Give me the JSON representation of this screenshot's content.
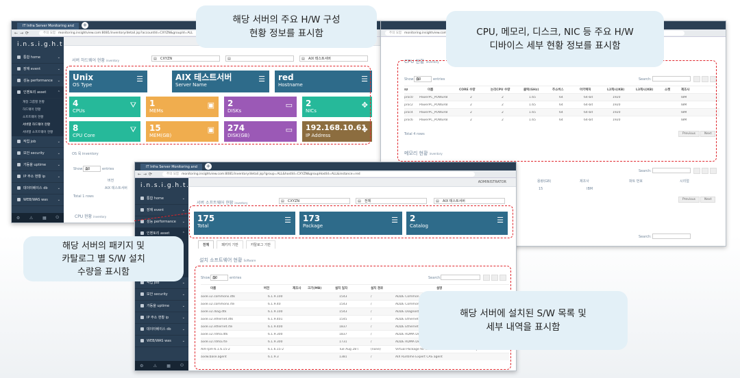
{
  "app": {
    "tab_title": "IT Infra Server Monitoring and",
    "url1": "monitoring.insightview.com:8081/inventory/detail.jsp?accountId=CXYZN&groupId=ALL",
    "url2": "monitoring.insightview.com:8081/inventory/detail.jsp?group=ALL&hostId=CXYZN&groupHostId=ALL&instance=red",
    "url3": "monitoring.insightview.com",
    "url_label": "주의 요함",
    "logo": "i.n.s.i.g.h.t.V.e.w",
    "admin": "ADMINISTRATOR"
  },
  "sidebar": {
    "items": [
      {
        "label": "통합 home"
      },
      {
        "label": "장애 event"
      },
      {
        "label": "성능 performance"
      },
      {
        "label": "인벤토리 asset"
      },
      {
        "label": "작업 job"
      },
      {
        "label": "보안 security"
      },
      {
        "label": "가동율 uptime"
      },
      {
        "label": "IP 주소 현황 ip"
      },
      {
        "label": "데이터베이스 db"
      },
      {
        "label": "WEB/WAS was"
      }
    ],
    "subitems": [
      {
        "label": "계정 그룹별 현황"
      },
      {
        "label": "하드웨어 현황"
      },
      {
        "label": "소프트웨어 현황"
      },
      {
        "label": "서버별 하드웨어 현황"
      },
      {
        "label": "서버별 소프트웨어 현황"
      }
    ]
  },
  "hw_window": {
    "breadcrumb": "서버 하드웨어 현황",
    "breadcrumb_small": "inventory",
    "select1": "CXYZN",
    "select2": "",
    "select3": "AIX 테스트서버",
    "tiles": [
      {
        "value": "Unix",
        "label": "OS Type",
        "icon": "server-icon",
        "color": "blue"
      },
      {
        "value": "AIX 테스트서버",
        "label": "Server Name",
        "icon": "server-icon",
        "color": "blue"
      },
      {
        "value": "red",
        "label": "Hostname",
        "icon": "server-icon",
        "color": "blue"
      },
      {
        "value": "4",
        "label": "CPUs",
        "icon": "road-icon",
        "color": "green"
      },
      {
        "value": "1",
        "label": "MEMs",
        "icon": "archive-icon",
        "color": "orange"
      },
      {
        "value": "2",
        "label": "DISKs",
        "icon": "hdd-icon",
        "color": "purple"
      },
      {
        "value": "2",
        "label": "NICs",
        "icon": "arrows-icon",
        "color": "brown"
      },
      {
        "value": "8",
        "label": "CPU Core",
        "icon": "road-icon",
        "color": "green"
      },
      {
        "value": "15",
        "label": "MEM(GB)",
        "icon": "archive-icon",
        "color": "orange"
      },
      {
        "value": "274",
        "label": "DISK(GB)",
        "icon": "hdd-icon",
        "color": "purple"
      },
      {
        "value": "192.168.10.61",
        "label": "IP Address",
        "icon": "arrows-icon",
        "color": "brown"
      }
    ],
    "os_section": "OS 목 inventory",
    "show": "Show",
    "entries": "entries",
    "show_n": "10",
    "col_version": "버전",
    "row_text": "AIX 테스트서버",
    "total": "Total 1 rows",
    "cpu_section": "CPU 현황",
    "cpu_section_small": "inventory"
  },
  "cpu_window": {
    "panel_title": "CPU 현황",
    "panel_small": "inventory",
    "show": "Show",
    "show_n": "50",
    "entries": "entries",
    "search": "Search:",
    "headers": [
      "ID",
      "이름",
      "CORE 수량",
      "논리CPU 수량",
      "클럭(GHz)",
      "주소버스",
      "아키텍처",
      "L2캐시(KB)",
      "L3캐시(KB)",
      "소켓",
      "제조사"
    ],
    "rows": [
      [
        "proc0",
        "PowerPC_POWER8",
        "2",
        "2",
        "1.65",
        "64",
        "64-bit",
        "1920",
        "",
        "",
        "IBM"
      ],
      [
        "proc2",
        "PowerPC_POWER8",
        "2",
        "2",
        "1.65",
        "64",
        "64-bit",
        "1920",
        "",
        "",
        "IBM"
      ],
      [
        "proc4",
        "PowerPC_POWER8",
        "2",
        "2",
        "1.65",
        "64",
        "64-bit",
        "1920",
        "",
        "",
        "IBM"
      ],
      [
        "proc6",
        "PowerPC_POWER8",
        "2",
        "2",
        "1.65",
        "64",
        "64-bit",
        "1920",
        "",
        "",
        "IBM"
      ]
    ],
    "total": "Total 4 rows",
    "prev": "Previous",
    "next": "Next",
    "mem_title": "메모리 현황",
    "mem_small": "inventory",
    "mem_headers": [
      "용량(GB)",
      "제조사",
      "파트 번호",
      "시리얼"
    ],
    "mem_row": [
      "15",
      "IBM",
      "",
      ""
    ],
    "search2": "Search:",
    "search3": "Search:"
  },
  "sw_window": {
    "breadcrumb": "서버 소프트웨어 현황",
    "breadcrumb_small": "inventory",
    "select1": "CXYZN",
    "select2": "전체",
    "select3": "AIX 테스트서버",
    "tiles": [
      {
        "value": "175",
        "label": "Total",
        "icon": "server-icon"
      },
      {
        "value": "173",
        "label": "Package",
        "icon": "server-icon"
      },
      {
        "value": "2",
        "label": "Catalog",
        "icon": "server-icon"
      }
    ],
    "tabs": [
      "전체",
      "패키지 기반",
      "카탈로그 기반"
    ],
    "section_title": "설치 소프트웨어 현황",
    "section_small": "Software",
    "show": "Show",
    "show_n": "50",
    "entries": "entries",
    "search": "Search:",
    "headers": [
      "이름",
      "버전",
      "제조사",
      "크기(MB)",
      "설치 일자",
      "설치 경로",
      "설명"
    ],
    "rows": [
      [
        "aixle.v2.commonx.dtk",
        "6.1.9.100",
        "",
        "",
        "1543",
        "/",
        "ADDE Common"
      ],
      [
        "aixle.v2.commonx.rte",
        "6.1.9.40",
        "",
        "",
        "1543",
        "/",
        "ADDE Common"
      ],
      [
        "aixle.v2.diag.dtk",
        "6.1.9.100",
        "",
        "",
        "1543",
        "/",
        "ADDE Diagnostic"
      ],
      [
        "aixle.v2.ethernet.dtk",
        "6.1.9.401",
        "",
        "",
        "1545",
        "/",
        "ADDE Ethernet"
      ],
      [
        "aixle.v2.ethernet.rte",
        "6.1.9.400",
        "",
        "",
        "1837",
        "/",
        "ADDE Ethernet"
      ],
      [
        "aixle.v2.rdma.dtk",
        "6.1.9.300",
        "",
        "",
        "1837",
        "/",
        "ADDE RDMA De"
      ],
      [
        "aixle.v2.rdma.rte",
        "6.1.9.300",
        "",
        "",
        "1731",
        "/",
        "ADDE RDMA De"
      ],
      [
        "AIX-rpm-6.1.6.15-2",
        "6.1.6.15-2",
        "",
        "",
        "Tue Aug 28 00",
        "(none)",
        "Virtual Package for libraries and shells installed on system"
      ],
      [
        "aixlw.base.agent",
        "6.1.9.3",
        "",
        "",
        "1381",
        "/",
        "AIX Runtime Expert CAS agent"
      ]
    ]
  },
  "callouts": {
    "hw": "해당 서버의 주요 H/W 구성\n현황 정보를 표시함",
    "cpu": "CPU, 메모리, 디스크, NIC 등 주요 H/W\n디바이스 세부 현황 정보를 표시함",
    "pkg": "해당 서버의 패키지 및\n카탈로그 별 S/W 설치\n수량을 표시함",
    "sw": "해당 서버에 설치된 S/W 목록 및\n세부 내역을 표시함"
  },
  "colors": {
    "sidebar": "#2a3f54",
    "tile_blue": "#2e6b8a",
    "tile_green": "#26b99a",
    "tile_orange": "#f0ad4e",
    "tile_purple": "#9b59b6",
    "tile_brown": "#8c6d3f",
    "highlight": "#e0242a",
    "callout_bg": "#e3f0f7"
  }
}
